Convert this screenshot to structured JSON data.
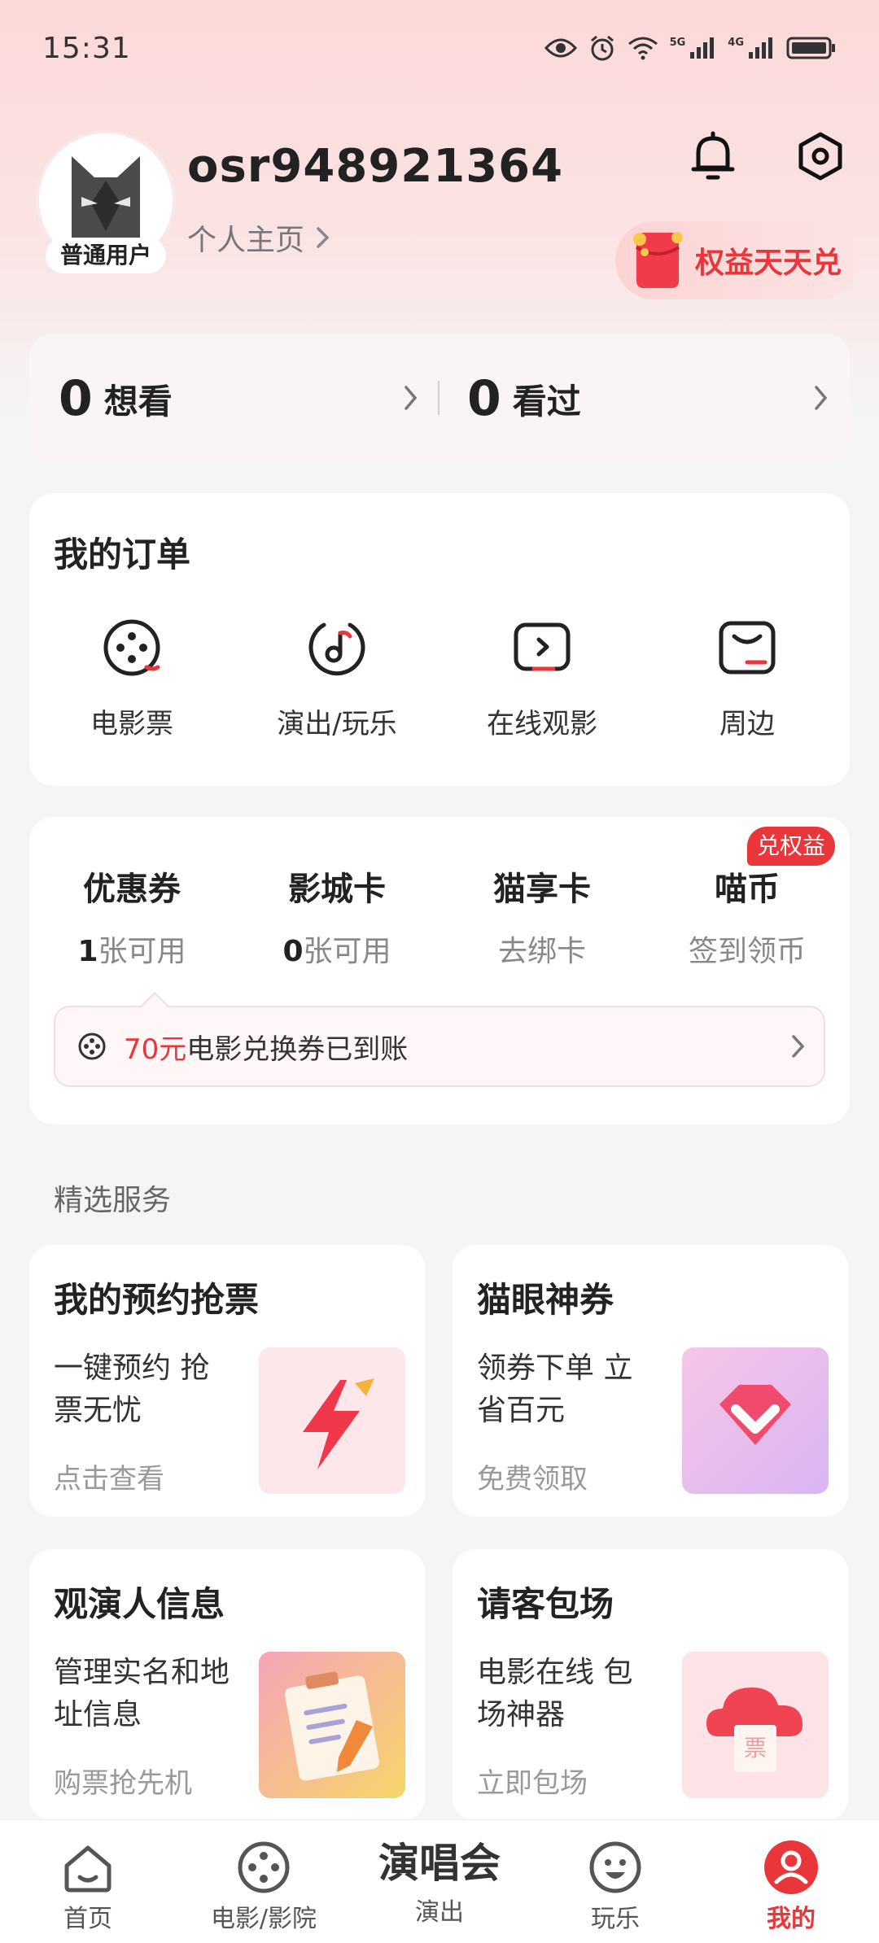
{
  "status_bar": {
    "time": "15:31",
    "net1": "5G",
    "net2": "4G"
  },
  "profile": {
    "username": "osr948921364",
    "badge": "普通用户",
    "homepage_link": "个人主页",
    "perk_button": "权益天天兑"
  },
  "watch": {
    "want": {
      "count": "0",
      "label": "想看"
    },
    "seen": {
      "count": "0",
      "label": "看过"
    }
  },
  "orders": {
    "title": "我的订单",
    "items": [
      {
        "label": "电影票",
        "icon": "film-reel-icon"
      },
      {
        "label": "演出/玩乐",
        "icon": "music-note-icon"
      },
      {
        "label": "在线观影",
        "icon": "play-screen-icon"
      },
      {
        "label": "周边",
        "icon": "shopping-bag-icon"
      }
    ]
  },
  "coupons": {
    "badge": "兑权益",
    "items": [
      {
        "title": "优惠券",
        "count": "1",
        "suffix": "张可用"
      },
      {
        "title": "影城卡",
        "count": "0",
        "suffix": "张可用"
      },
      {
        "title": "猫享卡",
        "sub": "去绑卡"
      },
      {
        "title": "喵币",
        "sub": "签到领币"
      }
    ],
    "banner": {
      "amount": "70元",
      "text": "电影兑换券已到账"
    }
  },
  "services": {
    "heading": "精选服务",
    "cards": [
      {
        "title": "我的预约抢票",
        "desc": "一键预约 抢票无忧",
        "link": "点击查看"
      },
      {
        "title": "猫眼神券",
        "desc": "领券下单 立省百元",
        "link": "免费领取"
      },
      {
        "title": "观演人信息",
        "desc": "管理实名和地址信息",
        "link": "购票抢先机"
      },
      {
        "title": "请客包场",
        "desc": "电影在线 包场神器",
        "link": "立即包场",
        "img_text": "票"
      }
    ]
  },
  "tabbar": {
    "items": [
      {
        "label": "首页"
      },
      {
        "label": "电影/影院"
      },
      {
        "label": "演出",
        "big": "演唱会"
      },
      {
        "label": "玩乐"
      },
      {
        "label": "我的"
      }
    ]
  },
  "colors": {
    "accent": "#e8363a",
    "background": "#f5f5f6",
    "header_pink": "#fcd9d9"
  }
}
